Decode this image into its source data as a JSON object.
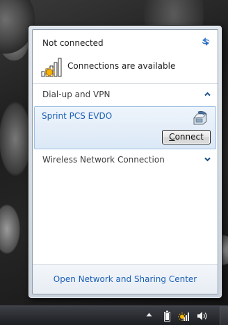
{
  "flyout": {
    "status_title": "Not connected",
    "available_text": "Connections are available",
    "groups": {
      "dialup": {
        "label": "Dial-up and VPN",
        "expanded": true,
        "connection": {
          "name": "Sprint PCS EVDO",
          "button_accel": "C",
          "button_rest": "onnect",
          "icon": "dialup-phone-icon"
        }
      },
      "wireless": {
        "label": "Wireless Network Connection",
        "expanded": false
      }
    },
    "footer_link": "Open Network and Sharing Center"
  },
  "taskbar": {
    "icons": [
      "show-hidden-icons-arrow",
      "battery-icon",
      "network-tray-icon",
      "volume-icon"
    ]
  },
  "colors": {
    "link": "#1a5fb4",
    "selected_bg": "#dbe8f6",
    "selected_border": "#9cc0e6"
  }
}
